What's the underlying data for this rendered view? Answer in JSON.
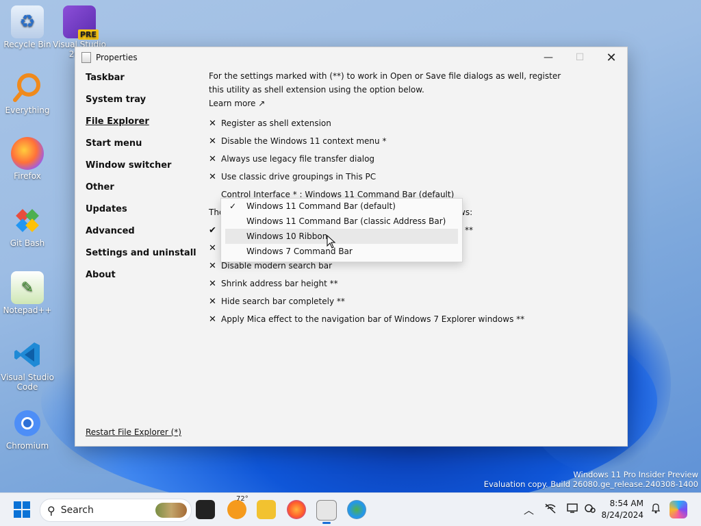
{
  "desktop": {
    "icons": [
      {
        "label": "Recycle Bin"
      },
      {
        "label": "Visual Studio 2022",
        "badge": "PRE"
      },
      {
        "label": "Everything"
      },
      {
        "label": "Firefox"
      },
      {
        "label": "Git Bash"
      },
      {
        "label": "Notepad++"
      },
      {
        "label": "Visual Studio Code"
      },
      {
        "label": "Chromium"
      }
    ],
    "watermark": {
      "line1": "Windows 11 Pro Insider Preview",
      "line2": "Evaluation copy. Build 26080.ge_release.240308-1400"
    }
  },
  "window": {
    "title": "Properties",
    "controls": {
      "minimize": "—",
      "maximize": "☐",
      "close": "✕"
    },
    "nav": {
      "items": [
        {
          "label": "Taskbar"
        },
        {
          "label": "System tray"
        },
        {
          "label": "File Explorer",
          "active": true
        },
        {
          "label": "Start menu"
        },
        {
          "label": "Window switcher"
        },
        {
          "label": "Other"
        },
        {
          "label": "Updates"
        },
        {
          "label": "Advanced"
        },
        {
          "label": "Settings and uninstall"
        },
        {
          "label": "About"
        }
      ],
      "restart_link": "Restart File Explorer (*)"
    },
    "content": {
      "intro_line1": "For the settings marked with (**) to work in Open or Save file dialogs as well, register",
      "intro_line2": "this utility as shell extension using the option below.",
      "learn_more": "Learn more ↗",
      "options_top": [
        {
          "mark": "✕",
          "label": "Register as shell extension"
        },
        {
          "mark": "✕",
          "label": "Disable the Windows 11 context menu *"
        },
        {
          "mark": "✕",
          "label": "Always use legacy file transfer dialog"
        },
        {
          "mark": "✕",
          "label": "Use classic drive groupings in This PC"
        }
      ],
      "control_interface": "Control Interface * : Windows 11 Command Bar (default)",
      "partial_heading_start": "The",
      "partial_heading_end": "ws:",
      "partial_opt1_mark": "✔",
      "partial_opt1_end": "**",
      "partial_opt2_mark": "✕",
      "partial_opt3": {
        "mark": "✕",
        "label": "Disable modern search bar"
      },
      "options_bottom": [
        {
          "mark": "✕",
          "label": "Shrink address bar height **"
        },
        {
          "mark": "✕",
          "label": "Hide search bar completely **"
        },
        {
          "mark": "✕",
          "label": "Apply Mica effect to the navigation bar of Windows 7 Explorer windows **"
        }
      ]
    },
    "dropdown": {
      "items": [
        {
          "label": "Windows 11 Command Bar (default)",
          "checked": true
        },
        {
          "label": "Windows 11 Command Bar (classic Address Bar)"
        },
        {
          "label": "Windows 10 Ribbon",
          "hover": true
        },
        {
          "label": "Windows 7 Command Bar"
        }
      ],
      "check_glyph": "✓"
    }
  },
  "taskbar": {
    "search_placeholder": "Search",
    "search_icon": "⚲",
    "weather_temp": "72°",
    "clock_time": "8:54 AM",
    "clock_date": "8/24/2024",
    "tray_chevron": "︿",
    "tray_icons": [
      "network-off-icon",
      "display-icon",
      "settings-sync-icon"
    ],
    "bell": "🔔"
  }
}
